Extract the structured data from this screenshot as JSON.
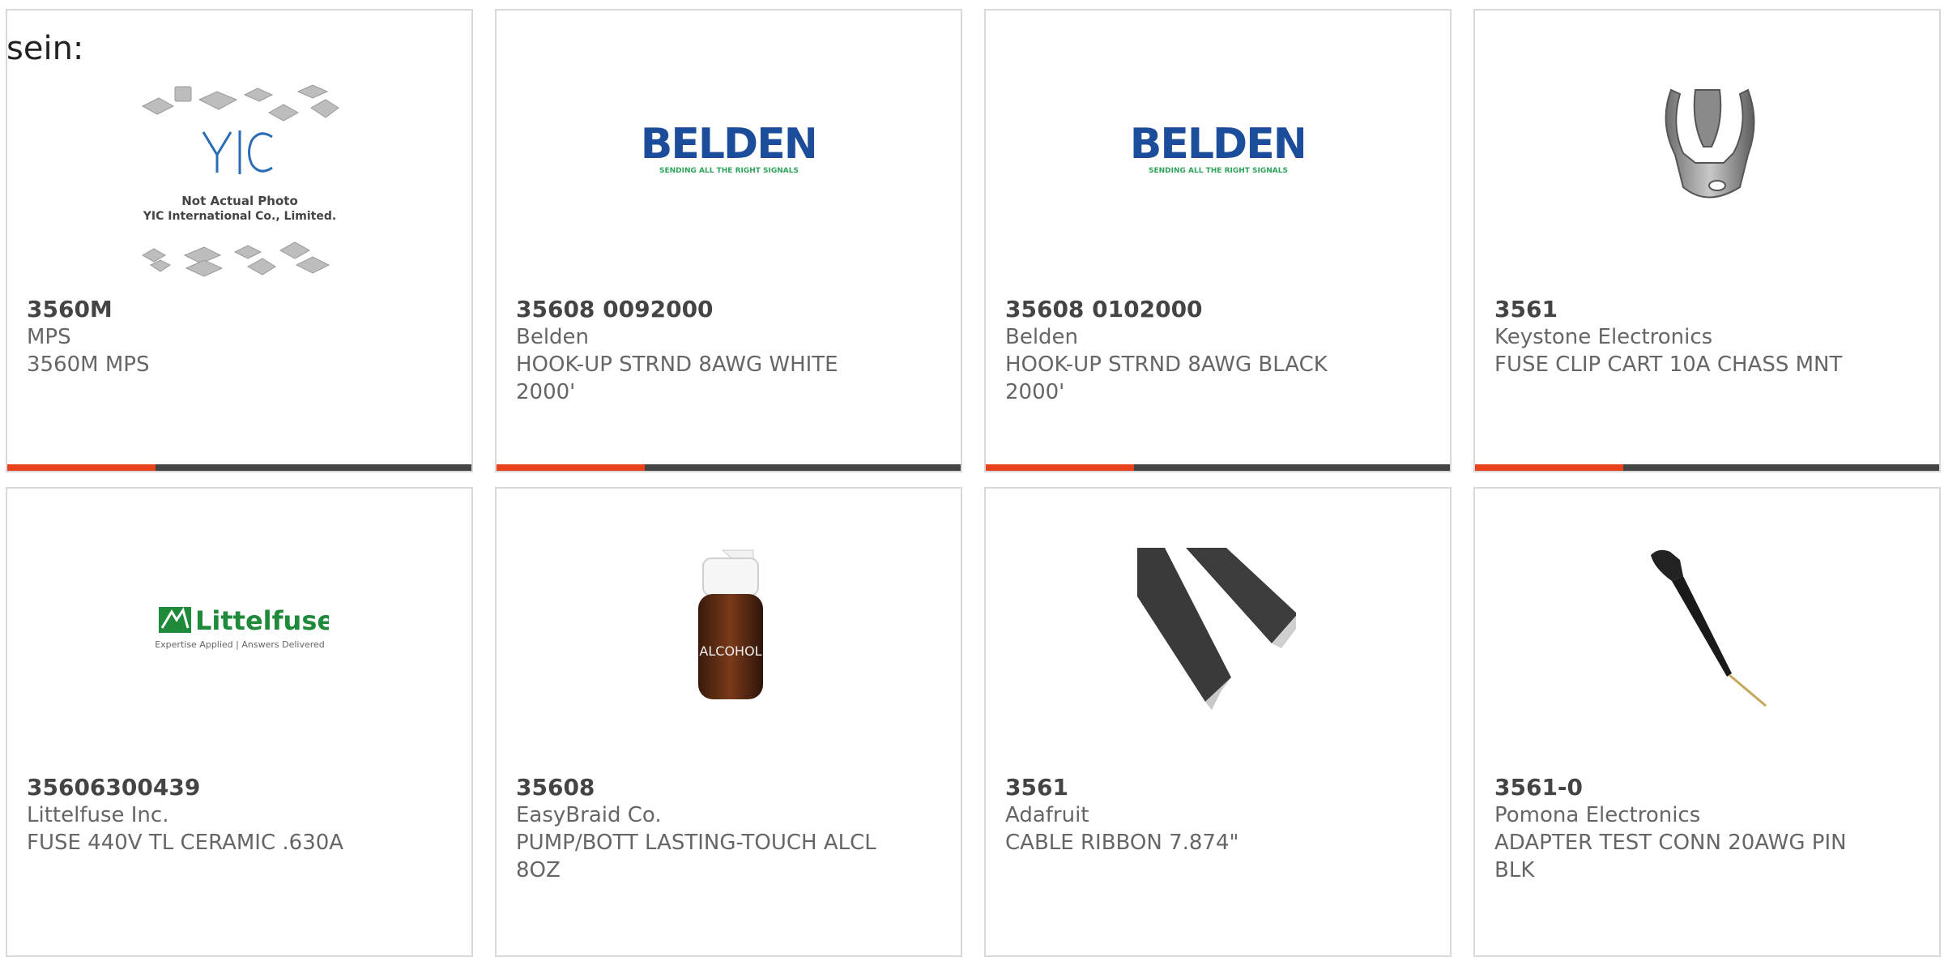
{
  "intro_text": "sein:",
  "colors": {
    "accent": "#e8431b",
    "bar": "#444444",
    "border": "#d9d9d9"
  },
  "cards": [
    {
      "part": "3560M",
      "manufacturer": "MPS",
      "description": "3560M MPS",
      "image": "yic-placeholder",
      "placeholder_line1": "Not Actual Photo",
      "placeholder_line2": "YIC International Co., Limited."
    },
    {
      "part": "35608 0092000",
      "manufacturer": "Belden",
      "description": "HOOK-UP STRND 8AWG WHITE 2000'",
      "image": "belden-logo",
      "logo_text": "BELDEN",
      "tagline": "SENDING ALL THE RIGHT SIGNALS"
    },
    {
      "part": "35608 0102000",
      "manufacturer": "Belden",
      "description": "HOOK-UP STRND 8AWG BLACK 2000'",
      "image": "belden-logo",
      "logo_text": "BELDEN",
      "tagline": "SENDING ALL THE RIGHT SIGNALS"
    },
    {
      "part": "3561",
      "manufacturer": "Keystone Electronics",
      "description": "FUSE CLIP CART 10A CHASS MNT",
      "image": "fuse-clip-photo"
    },
    {
      "part": "35606300439",
      "manufacturer": "Littelfuse Inc.",
      "description": "FUSE 440V TL CERAMIC .630A",
      "image": "littelfuse-logo",
      "logo_text": "Littelfuse",
      "tagline": "Expertise Applied | Answers Delivered"
    },
    {
      "part": "35608",
      "manufacturer": "EasyBraid Co.",
      "description": "PUMP/BOTT LASTING-TOUCH ALCL 8OZ",
      "image": "alcohol-bottle-photo",
      "label_text": "ALCOHOL"
    },
    {
      "part": "3561",
      "manufacturer": "Adafruit",
      "description": "CABLE RIBBON 7.874\"",
      "image": "ribbon-cable-photo"
    },
    {
      "part": "3561-0",
      "manufacturer": "Pomona Electronics",
      "description": "ADAPTER TEST CONN 20AWG PIN BLK",
      "image": "test-probe-photo"
    }
  ]
}
